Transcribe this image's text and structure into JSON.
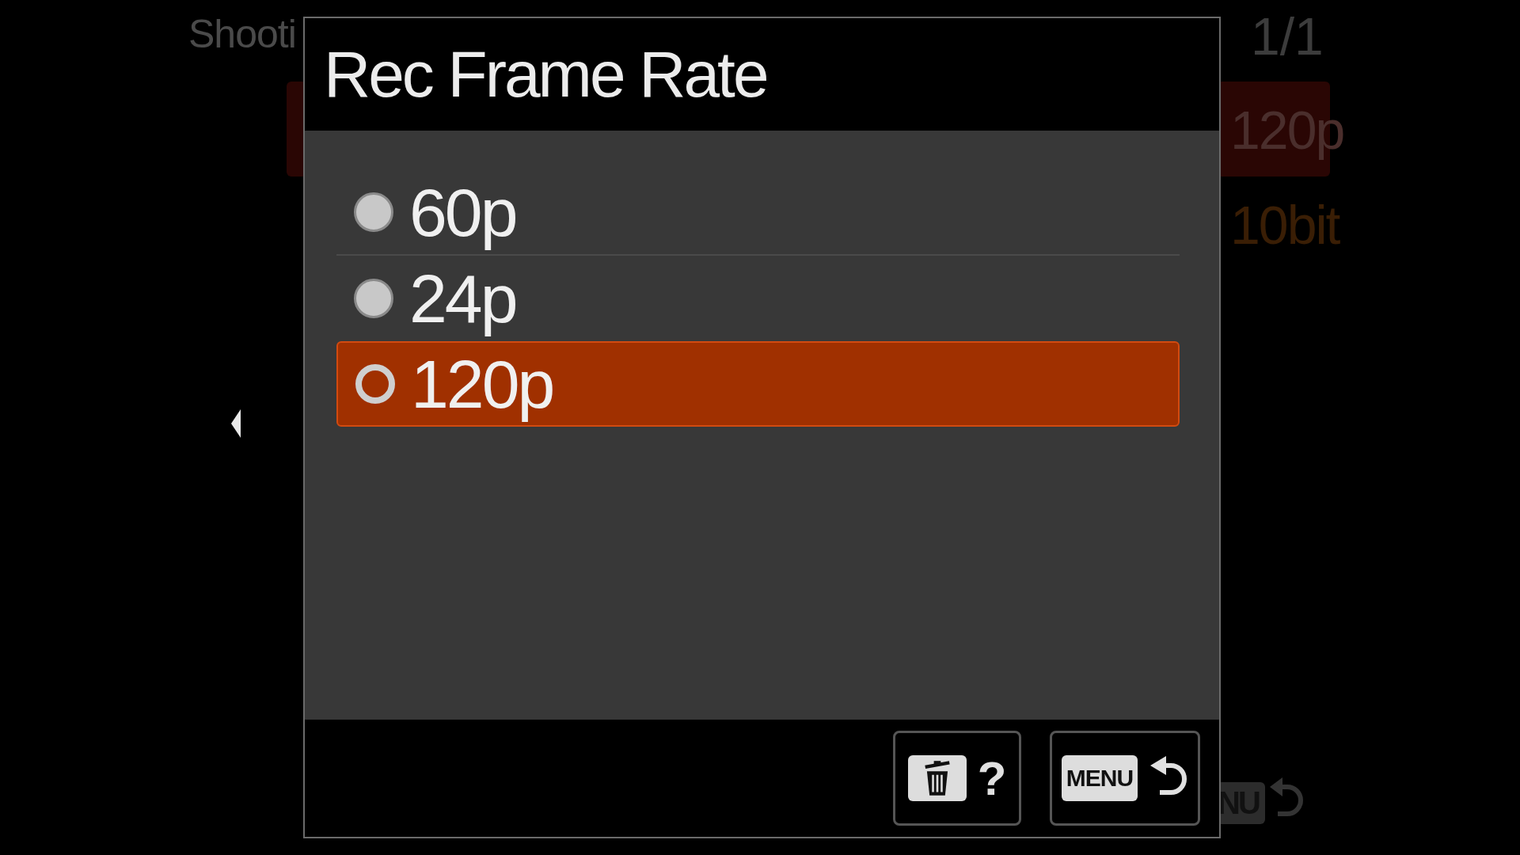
{
  "background_menu": {
    "title": "Shooti",
    "page": "1/1",
    "rows": [
      {
        "value": "120p",
        "selected": true
      },
      {
        "value": "10bit",
        "selected": false
      }
    ],
    "menu_key": "NU"
  },
  "dialog": {
    "title": "Rec Frame Rate",
    "options": [
      {
        "label": "60p",
        "selected": false
      },
      {
        "label": "24p",
        "selected": false
      },
      {
        "label": "120p",
        "selected": true
      }
    ],
    "buttons": [
      {
        "kind": "delete-help",
        "label": "?"
      },
      {
        "kind": "menu-back",
        "label": "MENU"
      }
    ]
  }
}
